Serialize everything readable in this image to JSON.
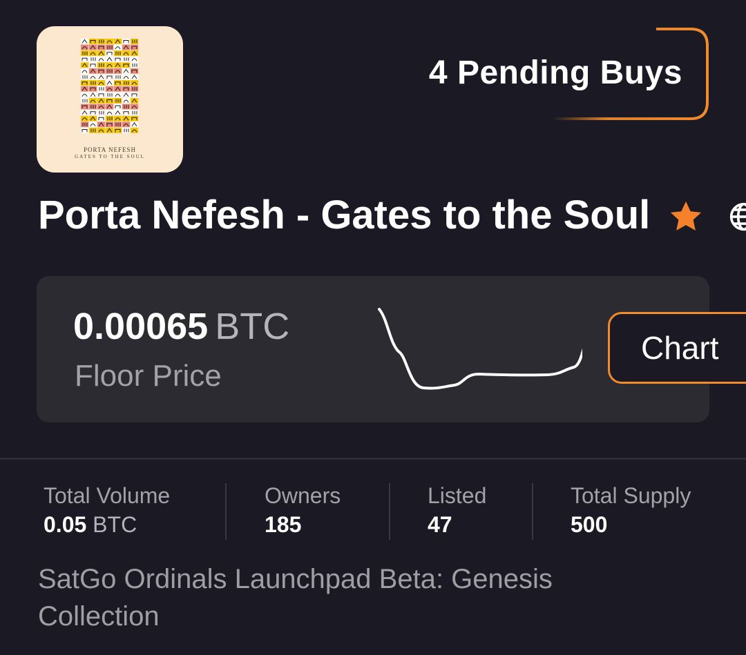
{
  "collection": {
    "thumbnail_caption_1": "PORTA NEFESH",
    "thumbnail_caption_2": "GATES TO THE SOUL",
    "title": "Porta Nefesh - Gates to the Soul",
    "description": "SatGo Ordinals Launchpad Beta: Genesis Collection"
  },
  "pending": {
    "label": "4 Pending Buys"
  },
  "floor": {
    "value": "0.00065",
    "unit": "BTC",
    "label": "Floor Price",
    "chart_button": "Chart"
  },
  "stats": [
    {
      "label": "Total Volume",
      "value": "0.05",
      "unit": "BTC"
    },
    {
      "label": "Owners",
      "value": "185"
    },
    {
      "label": "Listed",
      "value": "47"
    },
    {
      "label": "Total Supply",
      "value": "500"
    }
  ],
  "icons": {
    "favorite": "star-icon",
    "website": "globe-icon"
  },
  "colors": {
    "background": "#1b1a24",
    "card": "#2b2b31",
    "accent": "#f28b2e",
    "star": "#f5822b"
  }
}
